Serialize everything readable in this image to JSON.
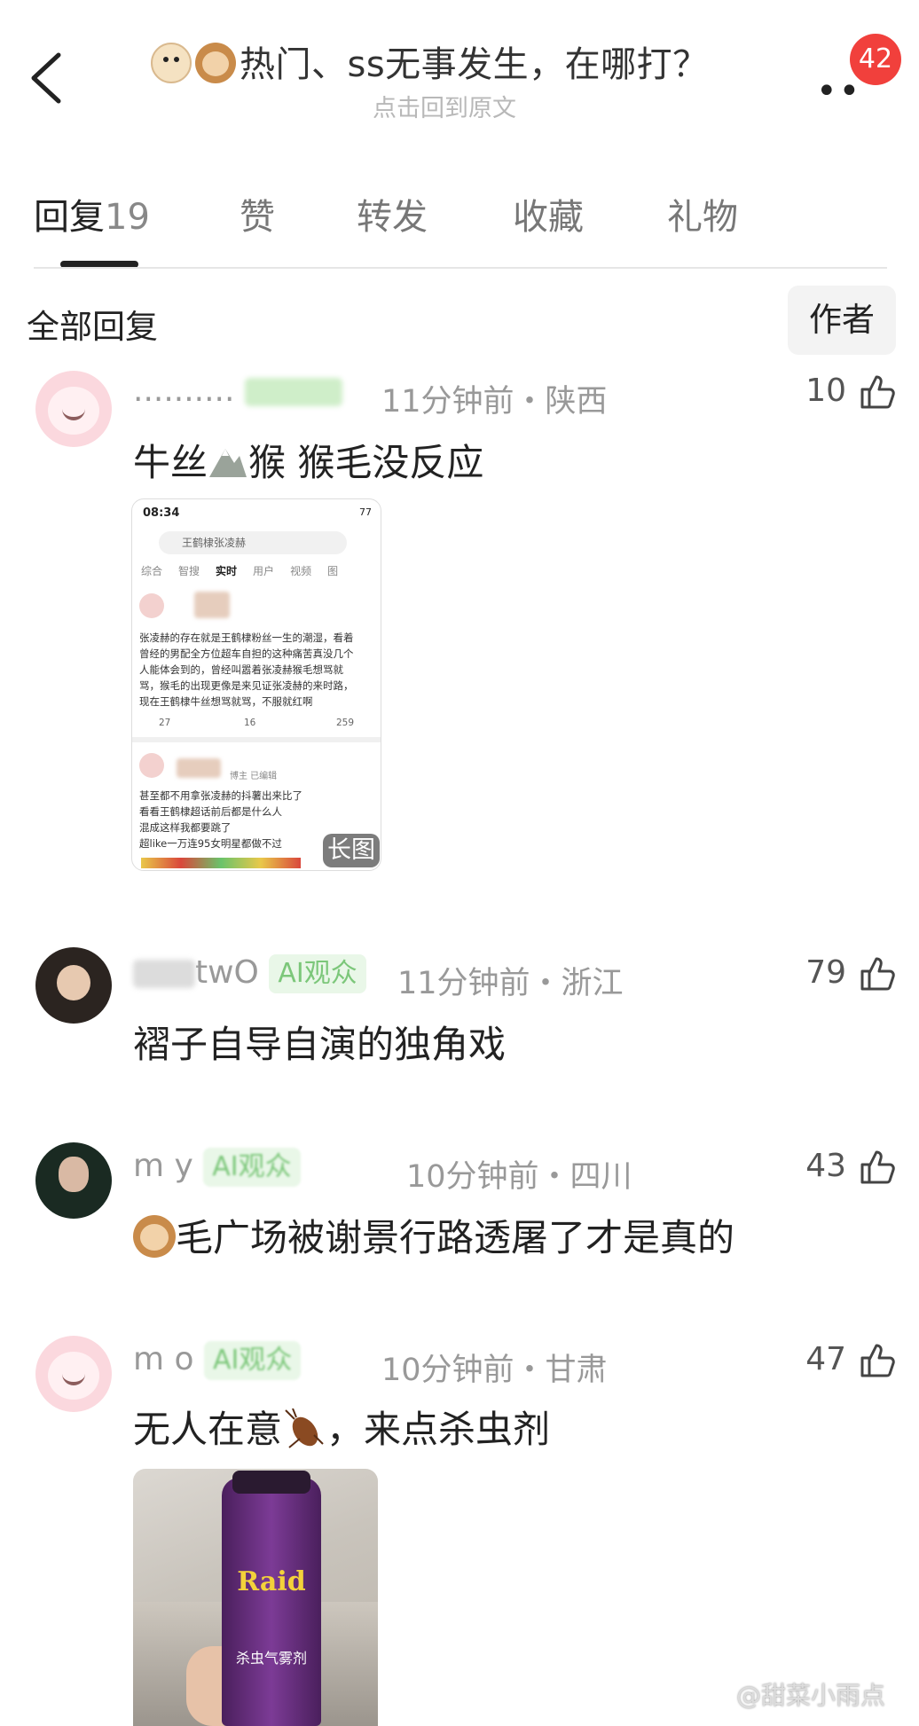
{
  "header": {
    "title": "热门、ss无事发生，在哪打？",
    "subtitle": "点击回到原文",
    "more_label": "••",
    "badge": "42"
  },
  "tabs": [
    {
      "label": "回复",
      "count": "19"
    },
    {
      "label": "赞"
    },
    {
      "label": "转发"
    },
    {
      "label": "收藏"
    },
    {
      "label": "礼物"
    }
  ],
  "section": {
    "title": "全部回复",
    "author_button": "作者"
  },
  "comments": [
    {
      "username": "..........",
      "meta": "11分钟前・陕西",
      "likes": "10",
      "text_a": "牛丝",
      "text_b": "猴 猴毛没反应",
      "screenshot": {
        "time": "08:34",
        "battery": "77",
        "search": "王鹤棣张凌赫",
        "tabs": [
          "综合",
          "智搜",
          "实时",
          "用户",
          "视频",
          "图"
        ],
        "lines": [
          "张凌赫的存在就是王鹤棣粉丝一生的潮湿，看着",
          "曾经的男配全方位超车自担的这种痛苦真没几个",
          "人能体会到的，曾经叫嚣着张凌赫猴毛想骂就",
          "骂，猴毛的出现更像是来见证张凌赫的来时路，",
          "现在王鹤棣牛丝想骂就骂，不服就红啊"
        ],
        "stats": [
          "27",
          "16",
          "259"
        ],
        "badge2": "博主 已编辑",
        "lines2": [
          "甚至都不用拿张凌赫的抖薯出来比了",
          "看看王鹤棣超话前后都是什么人",
          "混成这样我都要跳了",
          "超like一万连95女明星都做不过"
        ],
        "long_label": "长图"
      }
    },
    {
      "username": "twO",
      "tag": "AI观众",
      "meta": "11分钟前・浙江",
      "likes": "79",
      "text": "褶子自导自演的独角戏"
    },
    {
      "username": "m          y",
      "tag": "AI观众",
      "meta": "10分钟前・四川",
      "likes": "43",
      "text": "毛广场被谢景行路透屠了才是真的"
    },
    {
      "username": "m          o",
      "tag": "AI观众",
      "meta": "10分钟前・甘肃",
      "likes": "47",
      "text_a": "无人在意",
      "text_b": "，来点杀虫剂",
      "photo": {
        "brand": "Raid",
        "label": "杀虫气雾剂"
      }
    }
  ],
  "watermark": "@甜菜小雨点"
}
